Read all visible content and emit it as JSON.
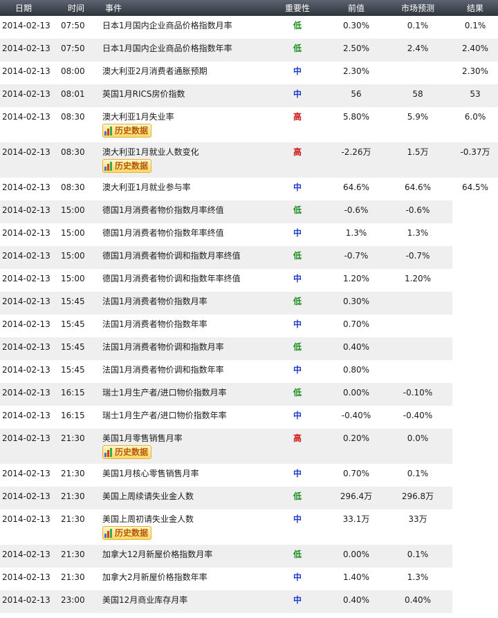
{
  "headers": {
    "date": "日期",
    "time": "时间",
    "event": "事件",
    "importance": "重要性",
    "previous": "前值",
    "forecast": "市场预测",
    "actual": "结果"
  },
  "history_label": "历史数据",
  "importance_colors": {
    "低": "#1a8a1a",
    "中": "#1a3acc",
    "高": "#cc1111"
  },
  "rows": [
    {
      "date": "2014-02-13",
      "time": "07:50",
      "event": "日本1月国内企业商品价格指数月率",
      "importance": "低",
      "previous": "0.30%",
      "forecast": "0.1%",
      "actual": "0.1%",
      "history": false
    },
    {
      "date": "2014-02-13",
      "time": "07:50",
      "event": "日本1月国内企业商品价格指数年率",
      "importance": "低",
      "previous": "2.50%",
      "forecast": "2.4%",
      "actual": "2.40%",
      "history": false
    },
    {
      "date": "2014-02-13",
      "time": "08:00",
      "event": "澳大利亚2月消费者通胀预期",
      "importance": "中",
      "previous": "2.30%",
      "forecast": "",
      "actual": "2.30%",
      "history": false
    },
    {
      "date": "2014-02-13",
      "time": "08:01",
      "event": "英国1月RICS房价指数",
      "importance": "中",
      "previous": "56",
      "forecast": "58",
      "actual": "53",
      "history": false
    },
    {
      "date": "2014-02-13",
      "time": "08:30",
      "event": "澳大利亚1月失业率",
      "importance": "高",
      "previous": "5.80%",
      "forecast": "5.9%",
      "actual": "6.0%",
      "history": true
    },
    {
      "date": "2014-02-13",
      "time": "08:30",
      "event": "澳大利亚1月就业人数变化",
      "importance": "高",
      "previous": "-2.26万",
      "forecast": "1.5万",
      "actual": "-0.37万",
      "history": true
    },
    {
      "date": "2014-02-13",
      "time": "08:30",
      "event": "澳大利亚1月就业参与率",
      "importance": "中",
      "previous": "64.6%",
      "forecast": "64.6%",
      "actual": "64.5%",
      "history": false
    },
    {
      "date": "2014-02-13",
      "time": "15:00",
      "event": "德国1月消费者物价指数月率终值",
      "importance": "低",
      "previous": "-0.6%",
      "forecast": "-0.6%",
      "actual": "",
      "history": false
    },
    {
      "date": "2014-02-13",
      "time": "15:00",
      "event": "德国1月消费者物价指数年率终值",
      "importance": "中",
      "previous": "1.3%",
      "forecast": "1.3%",
      "actual": "",
      "history": false
    },
    {
      "date": "2014-02-13",
      "time": "15:00",
      "event": "德国1月消费者物价调和指数月率终值",
      "importance": "低",
      "previous": "-0.7%",
      "forecast": "-0.7%",
      "actual": "",
      "history": false
    },
    {
      "date": "2014-02-13",
      "time": "15:00",
      "event": "德国1月消费者物价调和指数年率终值",
      "importance": "中",
      "previous": "1.20%",
      "forecast": "1.20%",
      "actual": "",
      "history": false
    },
    {
      "date": "2014-02-13",
      "time": "15:45",
      "event": "法国1月消费者物价指数月率",
      "importance": "低",
      "previous": "0.30%",
      "forecast": "",
      "actual": "",
      "history": false
    },
    {
      "date": "2014-02-13",
      "time": "15:45",
      "event": "法国1月消费者物价指数年率",
      "importance": "中",
      "previous": "0.70%",
      "forecast": "",
      "actual": "",
      "history": false
    },
    {
      "date": "2014-02-13",
      "time": "15:45",
      "event": "法国1月消费者物价调和指数月率",
      "importance": "低",
      "previous": "0.40%",
      "forecast": "",
      "actual": "",
      "history": false
    },
    {
      "date": "2014-02-13",
      "time": "15:45",
      "event": "法国1月消费者物价调和指数年率",
      "importance": "中",
      "previous": "0.80%",
      "forecast": "",
      "actual": "",
      "history": false
    },
    {
      "date": "2014-02-13",
      "time": "16:15",
      "event": "瑞士1月生产者/进口物价指数月率",
      "importance": "低",
      "previous": "0.00%",
      "forecast": "-0.10%",
      "actual": "",
      "history": false
    },
    {
      "date": "2014-02-13",
      "time": "16:15",
      "event": "瑞士1月生产者/进口物价指数年率",
      "importance": "中",
      "previous": "-0.40%",
      "forecast": "-0.40%",
      "actual": "",
      "history": false
    },
    {
      "date": "2014-02-13",
      "time": "21:30",
      "event": "美国1月零售销售月率",
      "importance": "高",
      "previous": "0.20%",
      "forecast": "0.0%",
      "actual": "",
      "history": true
    },
    {
      "date": "2014-02-13",
      "time": "21:30",
      "event": "美国1月核心零售销售月率",
      "importance": "中",
      "previous": "0.70%",
      "forecast": "0.1%",
      "actual": "",
      "history": false
    },
    {
      "date": "2014-02-13",
      "time": "21:30",
      "event": "美国上周续请失业金人数",
      "importance": "低",
      "previous": "296.4万",
      "forecast": "296.8万",
      "actual": "",
      "history": false
    },
    {
      "date": "2014-02-13",
      "time": "21:30",
      "event": "美国上周初请失业金人数",
      "importance": "中",
      "previous": "33.1万",
      "forecast": "33万",
      "actual": "",
      "history": true
    },
    {
      "date": "2014-02-13",
      "time": "21:30",
      "event": "加拿大12月新屋价格指数月率",
      "importance": "低",
      "previous": "0.00%",
      "forecast": "0.1%",
      "actual": "",
      "history": false
    },
    {
      "date": "2014-02-13",
      "time": "21:30",
      "event": "加拿大2月新屋价格指数年率",
      "importance": "中",
      "previous": "1.40%",
      "forecast": "1.3%",
      "actual": "",
      "history": false
    },
    {
      "date": "2014-02-13",
      "time": "23:00",
      "event": "美国12月商业库存月率",
      "importance": "中",
      "previous": "0.40%",
      "forecast": "0.40%",
      "actual": "",
      "history": false
    }
  ]
}
